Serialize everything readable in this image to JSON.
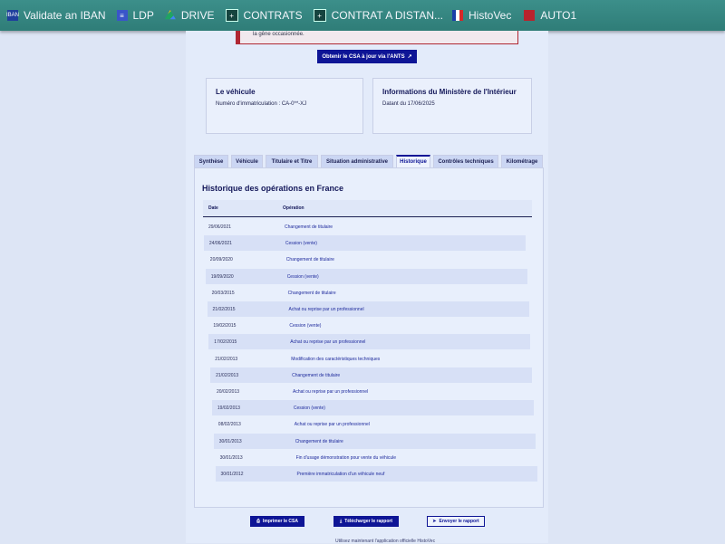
{
  "bookmarks": [
    {
      "label": "Validate an IBAN",
      "icon": "iban-icon"
    },
    {
      "label": "LDP",
      "icon": "ldp-icon"
    },
    {
      "label": "DRIVE",
      "icon": "drive-icon"
    },
    {
      "label": "CONTRATS",
      "icon": "document-icon"
    },
    {
      "label": "CONTRAT A DISTAN...",
      "icon": "document-icon"
    },
    {
      "label": "HistoVec",
      "icon": "histovec-icon"
    },
    {
      "label": "AUTO1",
      "icon": "auto1-icon"
    }
  ],
  "alert": {
    "text": "la gêne occasionnée."
  },
  "cta": {
    "label": "Obtenir le CSA à jour via l'ANTS",
    "icon": "external-link-icon"
  },
  "cards": {
    "vehicle": {
      "title": "Le véhicule",
      "text": "Numéro d'immatriculation : CA-0**-XJ"
    },
    "ministry": {
      "title": "Informations du Ministère de l'Intérieur",
      "text": "Datant du 17/06/2025"
    }
  },
  "tabs": [
    "Synthèse",
    "Véhicule",
    "Titulaire et Titre",
    "Situation administrative",
    "Historique",
    "Contrôles techniques",
    "Kilométrage"
  ],
  "active_tab": "Historique",
  "history": {
    "title": "Historique des opérations en France",
    "columns": {
      "date": "Date",
      "operation": "Opération"
    },
    "rows": [
      {
        "date": "29/06/2021",
        "operation": "Changement de titulaire"
      },
      {
        "date": "24/06/2021",
        "operation": "Cession (vente)"
      },
      {
        "date": "20/09/2020",
        "operation": "Changement de titulaire"
      },
      {
        "date": "19/09/2020",
        "operation": "Cession (vente)"
      },
      {
        "date": "20/03/2015",
        "operation": "Changement de titulaire"
      },
      {
        "date": "21/02/2015",
        "operation": "Achat ou reprise par un professionnel"
      },
      {
        "date": "19/02/2015",
        "operation": "Cession (vente)"
      },
      {
        "date": "17/02/2015",
        "operation": "Achat ou reprise par un professionnel"
      },
      {
        "date": "21/02/2013",
        "operation": "Modification des caractéristiques techniques"
      },
      {
        "date": "21/02/2013",
        "operation": "Changement de titulaire"
      },
      {
        "date": "20/02/2013",
        "operation": "Achat ou reprise par un professionnel"
      },
      {
        "date": "19/02/2013",
        "operation": "Cession (vente)"
      },
      {
        "date": "08/02/2013",
        "operation": "Achat ou reprise par un professionnel"
      },
      {
        "date": "30/01/2013",
        "operation": "Changement de titulaire"
      },
      {
        "date": "30/01/2013",
        "operation": "Fin d'usage démonstration pour vente du véhicule"
      },
      {
        "date": "30/01/2012",
        "operation": "Première immatriculation d'un véhicule neuf"
      }
    ]
  },
  "actions": {
    "print": "Imprimer le CSA",
    "download": "Télécharger le rapport",
    "send": "Envoyer le rapport"
  },
  "footer": "Utilisez maintenant l'application officielle HistoVec"
}
